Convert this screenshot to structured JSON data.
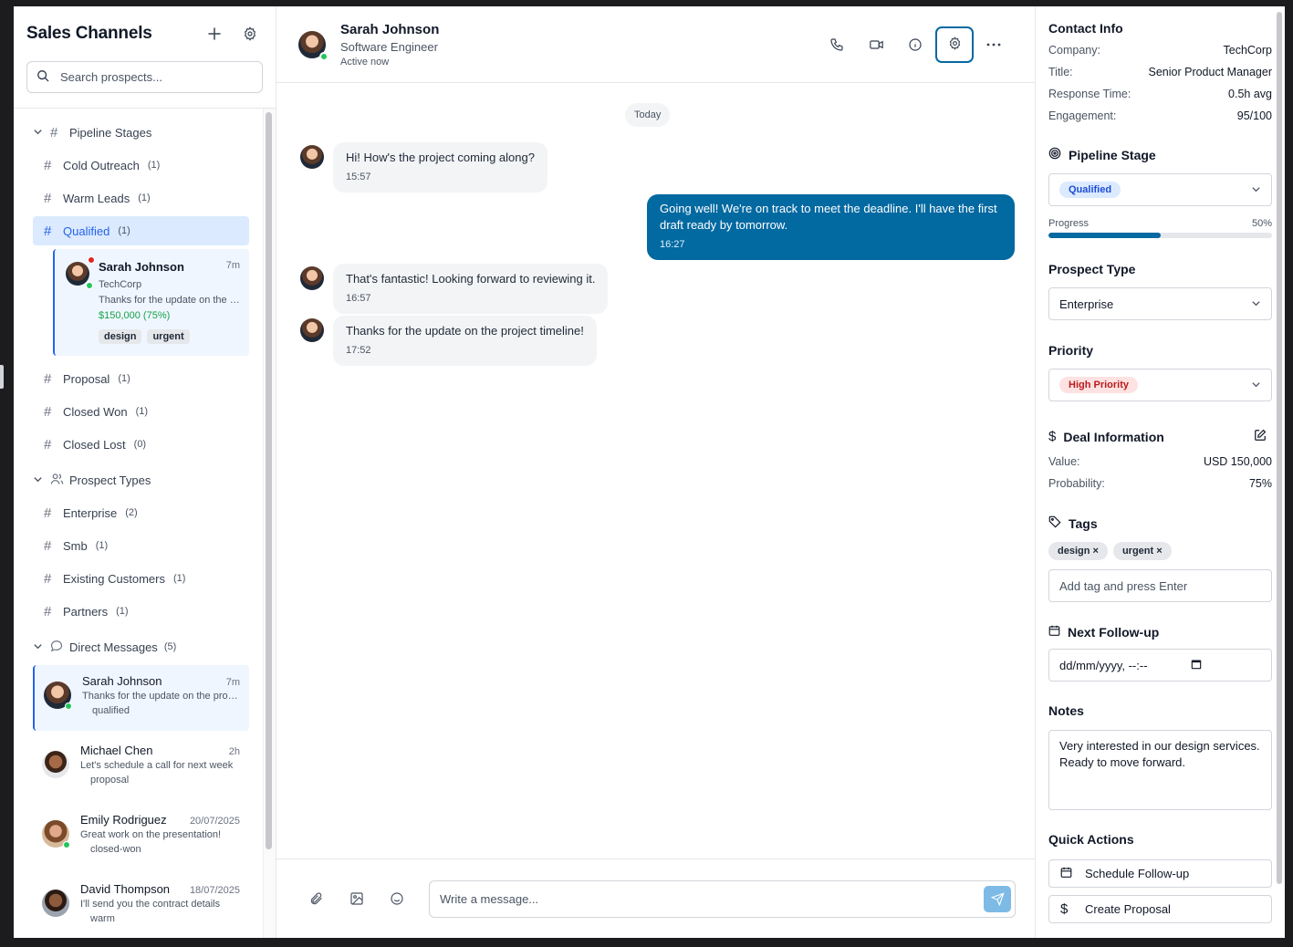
{
  "sidebar": {
    "title": "Sales Channels",
    "search_placeholder": "Search prospects...",
    "sections": {
      "pipeline": "Pipeline Stages",
      "prospect_types": "Prospect Types",
      "direct_messages": "Direct Messages",
      "direct_messages_count": "(5)"
    },
    "pipeline_items": [
      {
        "label": "Cold Outreach",
        "count": "(1)"
      },
      {
        "label": "Warm Leads",
        "count": "(1)"
      },
      {
        "label": "Qualified",
        "count": "(1)"
      },
      {
        "label": "Proposal",
        "count": "(1)"
      },
      {
        "label": "Closed Won",
        "count": "(1)"
      },
      {
        "label": "Closed Lost",
        "count": "(0)"
      }
    ],
    "prospect_card": {
      "name": "Sarah Johnson",
      "time": "7m",
      "company": "TechCorp",
      "snippet": "Thanks for the update on the project timeline!",
      "value": "$150,000 (75%)",
      "tags": [
        "design",
        "urgent"
      ]
    },
    "prospect_type_items": [
      {
        "label": "Enterprise",
        "count": "(2)"
      },
      {
        "label": "Smb",
        "count": "(1)"
      },
      {
        "label": "Existing Customers",
        "count": "(1)"
      },
      {
        "label": "Partners",
        "count": "(1)"
      }
    ],
    "dms": [
      {
        "name": "Sarah Johnson",
        "time": "7m",
        "snippet": "Thanks for the update on the project timeline!",
        "stage": "qualified"
      },
      {
        "name": "Michael Chen",
        "time": "2h",
        "snippet": "Let's schedule a call for next week",
        "stage": "proposal"
      },
      {
        "name": "Emily Rodriguez",
        "time": "20/07/2025",
        "snippet": "Great work on the presentation!",
        "stage": "closed-won"
      },
      {
        "name": "David Thompson",
        "time": "18/07/2025",
        "snippet": "I'll send you the contract details",
        "stage": "warm"
      }
    ]
  },
  "chat": {
    "name": "Sarah Johnson",
    "role": "Software Engineer",
    "status": "Active now",
    "day": "Today",
    "messages": [
      {
        "text": "Hi! How's the project coming along?",
        "time": "15:57"
      },
      {
        "text": "Going well! We're on track to meet the deadline. I'll have the first draft ready by tomorrow.",
        "time": "16:27"
      },
      {
        "text": "That's fantastic! Looking forward to reviewing it.",
        "time": "16:57"
      },
      {
        "text": "Thanks for the update on the project timeline!",
        "time": "17:52"
      }
    ],
    "composer_placeholder": "Write a message..."
  },
  "panel": {
    "contact_title": "Contact Info",
    "contact": [
      {
        "k": "Company:",
        "v": "TechCorp"
      },
      {
        "k": "Title:",
        "v": "Senior Product Manager"
      },
      {
        "k": "Response Time:",
        "v": "0.5h avg"
      },
      {
        "k": "Engagement:",
        "v": "95/100"
      }
    ],
    "pipeline_title": "Pipeline Stage",
    "pipeline_value": "Qualified",
    "progress_label": "Progress",
    "progress_text": "50%",
    "progress_fraction": 0.5,
    "prospect_type_title": "Prospect Type",
    "prospect_type_value": "Enterprise",
    "priority_title": "Priority",
    "priority_value": "High Priority",
    "deal_title": "Deal Information",
    "deal": [
      {
        "k": "Value:",
        "v": "USD 150,000"
      },
      {
        "k": "Probability:",
        "v": "75%"
      }
    ],
    "tags_title": "Tags",
    "tags": [
      "design ×",
      "urgent ×"
    ],
    "tag_placeholder": "Add tag and press Enter",
    "followup_title": "Next Follow-up",
    "followup_placeholder": "dd/mm/yyyy, --:--",
    "notes_title": "Notes",
    "notes_text": "Very interested in our design services. Ready to move forward.",
    "quick_title": "Quick Actions",
    "quick_actions": [
      "Schedule Follow-up",
      "Create Proposal"
    ]
  },
  "colors": {
    "accent": "#0369a1",
    "active_bg": "#dbeafe",
    "online": "#22c55e"
  },
  "icons": [
    "plus-icon",
    "gear-icon",
    "search-icon",
    "chevron-down-icon",
    "hash-icon",
    "users-icon",
    "chat-bubble-icon",
    "phone-icon",
    "video-icon",
    "info-icon",
    "more-icon",
    "paperclip-icon",
    "image-icon",
    "smile-icon",
    "send-icon",
    "target-icon",
    "dollar-icon",
    "edit-icon",
    "tag-icon",
    "calendar-icon"
  ]
}
